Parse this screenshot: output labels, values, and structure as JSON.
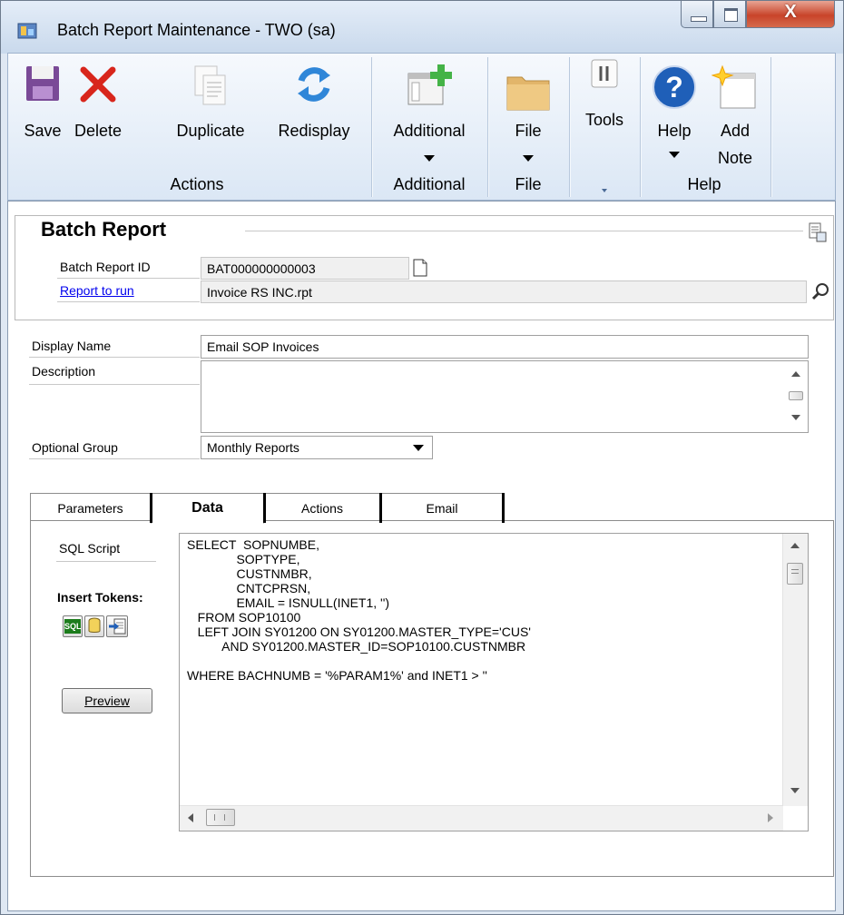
{
  "window": {
    "title": "Batch Report Maintenance  -  TWO (sa)",
    "close_glyph": "X"
  },
  "ribbon": {
    "save": "Save",
    "delete": "Delete",
    "duplicate": "Duplicate",
    "redisplay": "Redisplay",
    "additional": "Additional",
    "file": "File",
    "tools": "Tools",
    "help": "Help",
    "add": "Add",
    "note": "Note",
    "groups": {
      "actions": "Actions",
      "additional": "Additional",
      "file": "File",
      "help": "Help"
    }
  },
  "header": {
    "title": "Batch Report",
    "batch_report_id_label": "Batch Report ID",
    "batch_report_id_value": "BAT000000000003",
    "report_to_run_label": "Report to run",
    "report_to_run_value": "Invoice RS INC.rpt"
  },
  "form": {
    "display_name_label": "Display Name",
    "display_name_value": "Email SOP Invoices",
    "description_label": "Description",
    "description_value": "",
    "optional_group_label": "Optional Group",
    "optional_group_value": "Monthly Reports"
  },
  "tabs": [
    {
      "label": "Parameters",
      "active": false
    },
    {
      "label": "Data",
      "active": true
    },
    {
      "label": "Actions",
      "active": false
    },
    {
      "label": "Email",
      "active": false
    }
  ],
  "data_tab": {
    "sql_script_label": "SQL Script",
    "insert_tokens_label": "Insert Tokens:",
    "token_sql_label": "SQL",
    "preview_label": "Preview",
    "sql_script": "SELECT  SOPNUMBE,\n              SOPTYPE,\n              CUSTNMBR,\n              CNTCPRSN,\n              EMAIL = ISNULL(INET1, '')\n   FROM SOP10100\n   LEFT JOIN SY01200 ON SY01200.MASTER_TYPE='CUS'\n          AND SY01200.MASTER_ID=SOP10100.CUSTNMBR\n\nWHERE BACHNUMB = '%PARAM1%' and INET1 > ''"
  },
  "colors": {
    "ribbon_bg": "#dbe7f5",
    "link": "#0000ee",
    "close_button": "#c8442a"
  },
  "icons": [
    "app-icon",
    "save-icon",
    "delete-icon",
    "duplicate-icon",
    "redisplay-icon",
    "additional-icon",
    "file-icon",
    "tools-icon",
    "help-icon",
    "add-note-icon",
    "note-icon",
    "lookup-icon",
    "header-options-icon",
    "dropdown-arrow-icon",
    "sql-token-icon",
    "database-token-icon",
    "insert-token-icon"
  ]
}
